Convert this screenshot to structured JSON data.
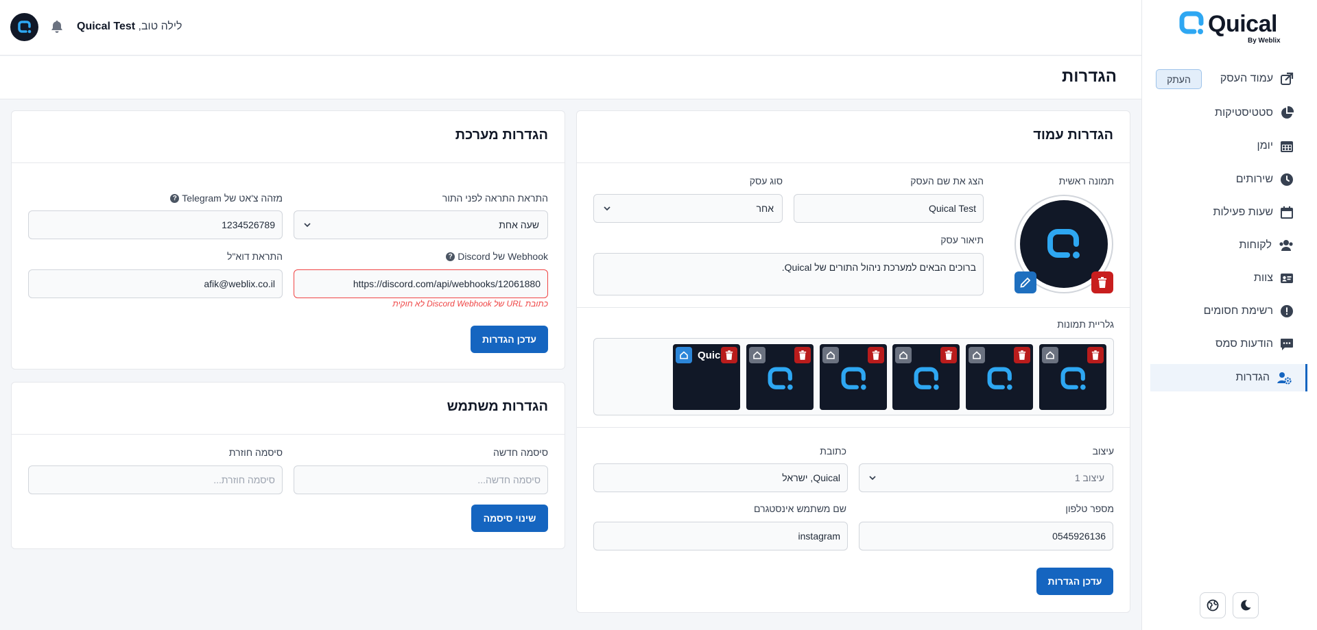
{
  "brand": {
    "name": "Quical",
    "by": "By Weblix",
    "accent": "#1565c0",
    "logo_blue": "#2ea7f2"
  },
  "header": {
    "user_name": "Quical Test",
    "greeting": "לילה טוב,"
  },
  "page_title": "הגדרות",
  "sidebar": {
    "copy_label": "העתק",
    "items": [
      {
        "label": "עמוד העסק",
        "icon": "external-link-icon"
      },
      {
        "label": "סטטיסטיקות",
        "icon": "pie-chart-icon"
      },
      {
        "label": "יומן",
        "icon": "calendar-grid-icon"
      },
      {
        "label": "שירותים",
        "icon": "clock-icon"
      },
      {
        "label": "שעות פעילות",
        "icon": "calendar-icon"
      },
      {
        "label": "לקוחות",
        "icon": "users-icon"
      },
      {
        "label": "צוות",
        "icon": "id-card-icon"
      },
      {
        "label": "רשימת חסומים",
        "icon": "alert-circle-icon"
      },
      {
        "label": "הודעות סמס",
        "icon": "message-icon"
      },
      {
        "label": "הגדרות",
        "icon": "user-cog-icon",
        "active": true
      }
    ]
  },
  "page_settings": {
    "title": "הגדרות עמוד",
    "main_image_label": "תמונה ראשית",
    "business_name_label": "הצג את שם העסק",
    "business_name_value": "Quical Test",
    "business_type_label": "סוג עסק",
    "business_type_value": "אחר",
    "description_label": "תיאור עסק",
    "description_value": "ברוכים הבאים למערכת ניהול התורים של Quical.",
    "gallery_label": "גלריית תמונות",
    "gallery_main_text": "Quic",
    "design_label": "עיצוב",
    "design_value": "עיצוב 1",
    "address_label": "כתובת",
    "address_value": "Quical, ישראל",
    "phone_label": "מספר טלפון",
    "phone_value": "0545926136",
    "instagram_label": "שם משתמש אינסטגרם",
    "instagram_value": "instagram",
    "update_button": "עדכן הגדרות"
  },
  "system_settings": {
    "title": "הגדרות מערכת",
    "reminder_label": "התראת התראה לפני התור",
    "reminder_value": "שעה אחת",
    "telegram_label": "מזהה צ'אט של Telegram",
    "telegram_value": "1234526789",
    "discord_label": "Webhook של Discord",
    "discord_value": "https://discord.com/api/webhooks/12061880",
    "discord_error": "כתובת URL של Discord Webhook לא חוקית",
    "email_label": "התראת דוא\"ל",
    "email_value": "afik@weblix.co.il",
    "update_button": "עדכן הגדרות"
  },
  "user_settings": {
    "title": "הגדרות משתמש",
    "new_password_label": "סיסמה חדשה",
    "new_password_placeholder": "סיסמה חדשה...",
    "repeat_password_label": "סיסמה חוזרת",
    "repeat_password_placeholder": "סיסמה חוזרת...",
    "change_button": "שינוי סיסמה"
  }
}
